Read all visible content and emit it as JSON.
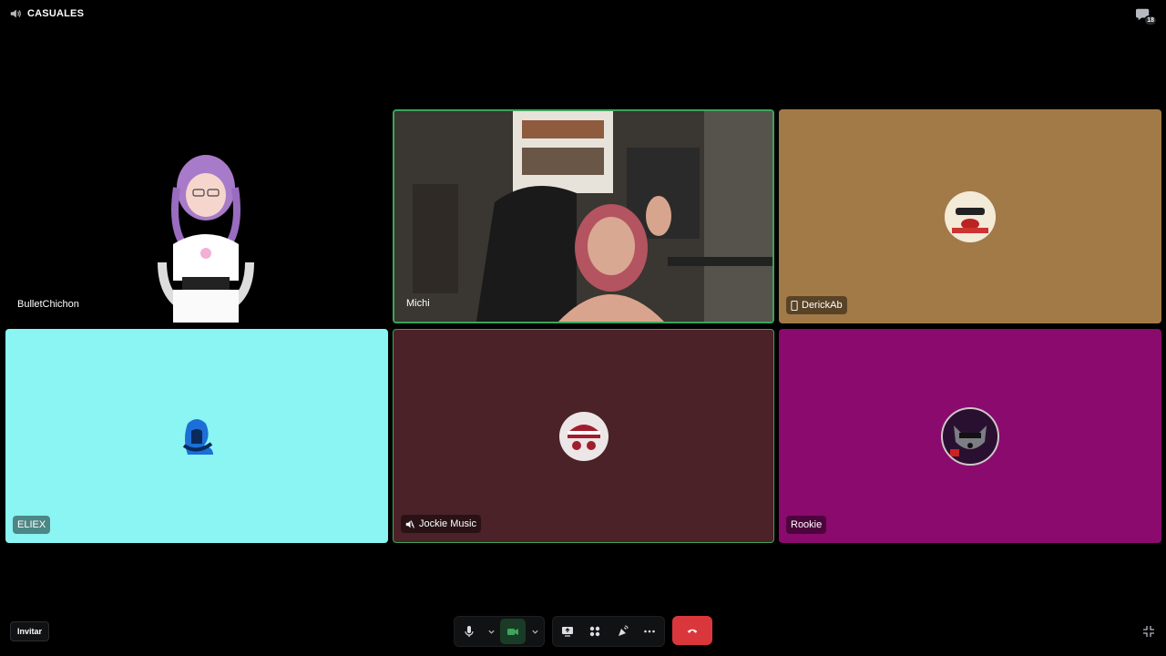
{
  "channel": {
    "name": "CASUALES"
  },
  "chat": {
    "badge": "18"
  },
  "tiles": [
    {
      "name": "BulletChichon"
    },
    {
      "name": "Michi"
    },
    {
      "name": "DerickAb"
    },
    {
      "name": "ELIEX"
    },
    {
      "name": "Jockie Music"
    },
    {
      "name": "Rookie"
    }
  ],
  "invite_label": "Invitar",
  "colors": {
    "speaking": "#3ba55c",
    "end_call": "#da373c",
    "derick_bg": "#a27a48",
    "eliex_bg": "#8af5f3",
    "jockie_bg": "#4a2228",
    "rookie_bg": "#8b0a6d"
  }
}
